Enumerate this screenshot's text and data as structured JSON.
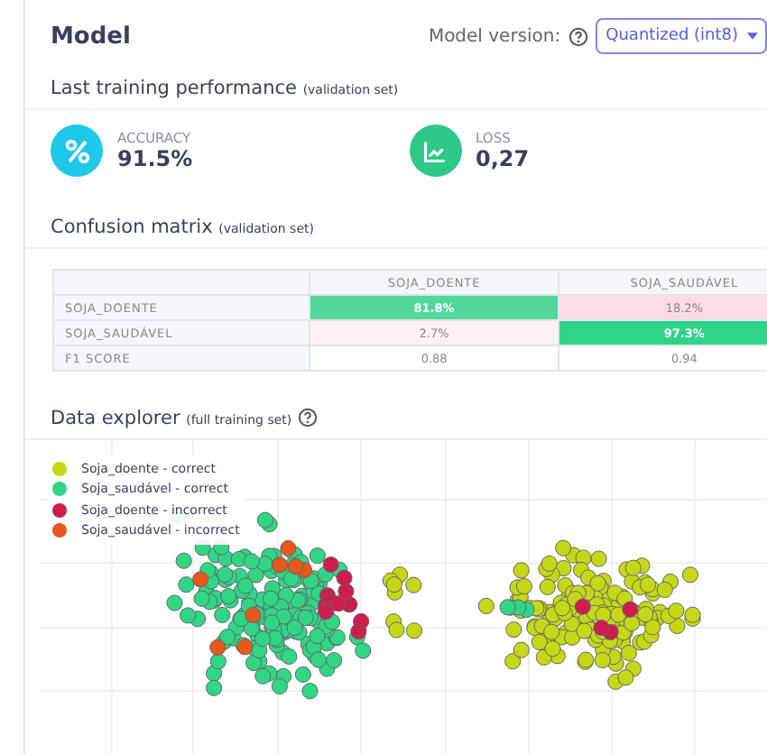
{
  "header": {
    "title": "Model",
    "version_label": "Model version:",
    "version_value": "Quantized (int8)"
  },
  "performance": {
    "title": "Last training performance",
    "note": "(validation set)",
    "metrics": [
      {
        "kind": "accuracy",
        "label": "ACCURACY",
        "value": "91.5%"
      },
      {
        "kind": "loss",
        "label": "LOSS",
        "value": "0,27"
      }
    ]
  },
  "confusion_matrix": {
    "title": "Confusion matrix",
    "note": "(validation set)",
    "columns": [
      "SOJA_DOENTE",
      "SOJA_SAUDÁVEL"
    ],
    "rows": [
      {
        "label": "SOJA_DOENTE",
        "cells": [
          {
            "text": "81.8%",
            "color": "#52d89c"
          },
          {
            "text": "18.2%",
            "color": "#fddde3"
          }
        ]
      },
      {
        "label": "SOJA_SAUDÁVEL",
        "cells": [
          {
            "text": "2.7%",
            "color": "#fff0f3"
          },
          {
            "text": "97.3%",
            "color": "#2ed48a"
          }
        ]
      },
      {
        "label": "F1 SCORE",
        "cells": [
          {
            "text": "0.88",
            "color": "#ffffff"
          },
          {
            "text": "0.94",
            "color": "#ffffff"
          }
        ]
      }
    ]
  },
  "data_explorer": {
    "title": "Data explorer",
    "note": "(full training set)",
    "legend": [
      {
        "label": "Soja_doente - correct",
        "color": "#c5d818"
      },
      {
        "label": "Soja_saudável - correct",
        "color": "#30d686"
      },
      {
        "label": "Soja_doente - incorrect",
        "color": "#cc1d4e"
      },
      {
        "label": "Soja_saudável - incorrect",
        "color": "#e8571c"
      }
    ]
  }
}
